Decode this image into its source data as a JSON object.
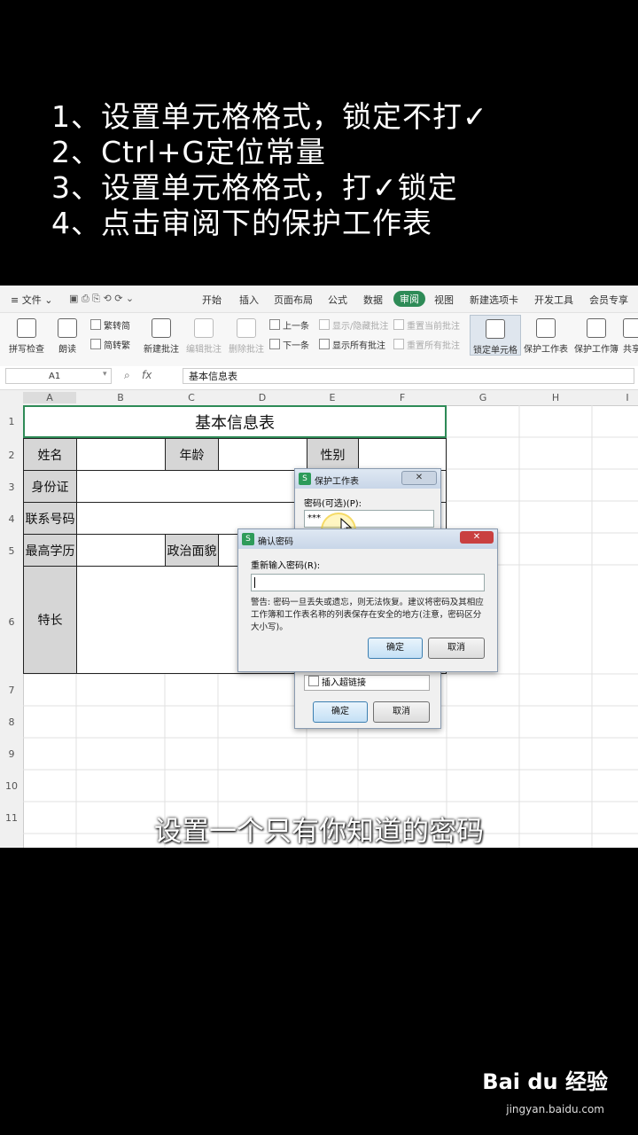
{
  "instructions": [
    "1、设置单元格格式，锁定不打✓",
    "2、Ctrl+G定位常量",
    "3、设置单元格格式，打✓锁定",
    "4、点击审阅下的保护工作表"
  ],
  "menubar": {
    "file": "文件",
    "tabs": [
      "开始",
      "插入",
      "页面布局",
      "公式",
      "数据",
      "审阅",
      "视图",
      "新建选项卡",
      "开发工具",
      "会员专享"
    ],
    "active_tab": "审阅"
  },
  "ribbon": {
    "spellcheck": "拼写检查",
    "read": "朗读",
    "trad2simp": "繁转简",
    "simp2trad": "简转繁",
    "new_comment": "新建批注",
    "edit_comment": "编辑批注",
    "delete_comment": "删除批注",
    "prev": "上一条",
    "next": "下一条",
    "show_hide_comment": "显示/隐藏批注",
    "show_all_comments": "显示所有批注",
    "reset_current": "重置当前批注",
    "reset_all": "重置所有批注",
    "lock_cell": "锁定单元格",
    "protect_sheet": "保护工作表",
    "protect_book": "保护工作簿",
    "share": "共享"
  },
  "formula_bar": {
    "name_box": "A1",
    "fx": "fx",
    "content": "基本信息表"
  },
  "columns": [
    "A",
    "B",
    "C",
    "D",
    "E",
    "F",
    "G",
    "H",
    "I"
  ],
  "rows": [
    "1",
    "2",
    "3",
    "4",
    "5",
    "6",
    "7",
    "8",
    "9",
    "10",
    "11"
  ],
  "table": {
    "title": "基本信息表",
    "name": "姓名",
    "age": "年龄",
    "gender": "性别",
    "id_card": "身份证",
    "phone": "联系号码",
    "education": "最高学历",
    "political": "政治面貌",
    "specialty": "特长"
  },
  "protect_dialog": {
    "title": "保护工作表",
    "password_label": "密码(可选)(P):",
    "password_value": "***",
    "insert_hyperlink": "插入超链接",
    "ok": "确定",
    "cancel": "取消"
  },
  "confirm_dialog": {
    "title": "确认密码",
    "reenter_label": "重新输入密码(R):",
    "warning": "警告: 密码一旦丢失或遗忘，则无法恢复。建议将密码及其相应工作簿和工作表名称的列表保存在安全的地方(注意，密码区分大小写)。",
    "ok": "确定",
    "cancel": "取消"
  },
  "subtitle": "设置一个只有你知道的密码",
  "watermark": {
    "brand": "Bai du 经验",
    "url": "jingyan.baidu.com"
  }
}
